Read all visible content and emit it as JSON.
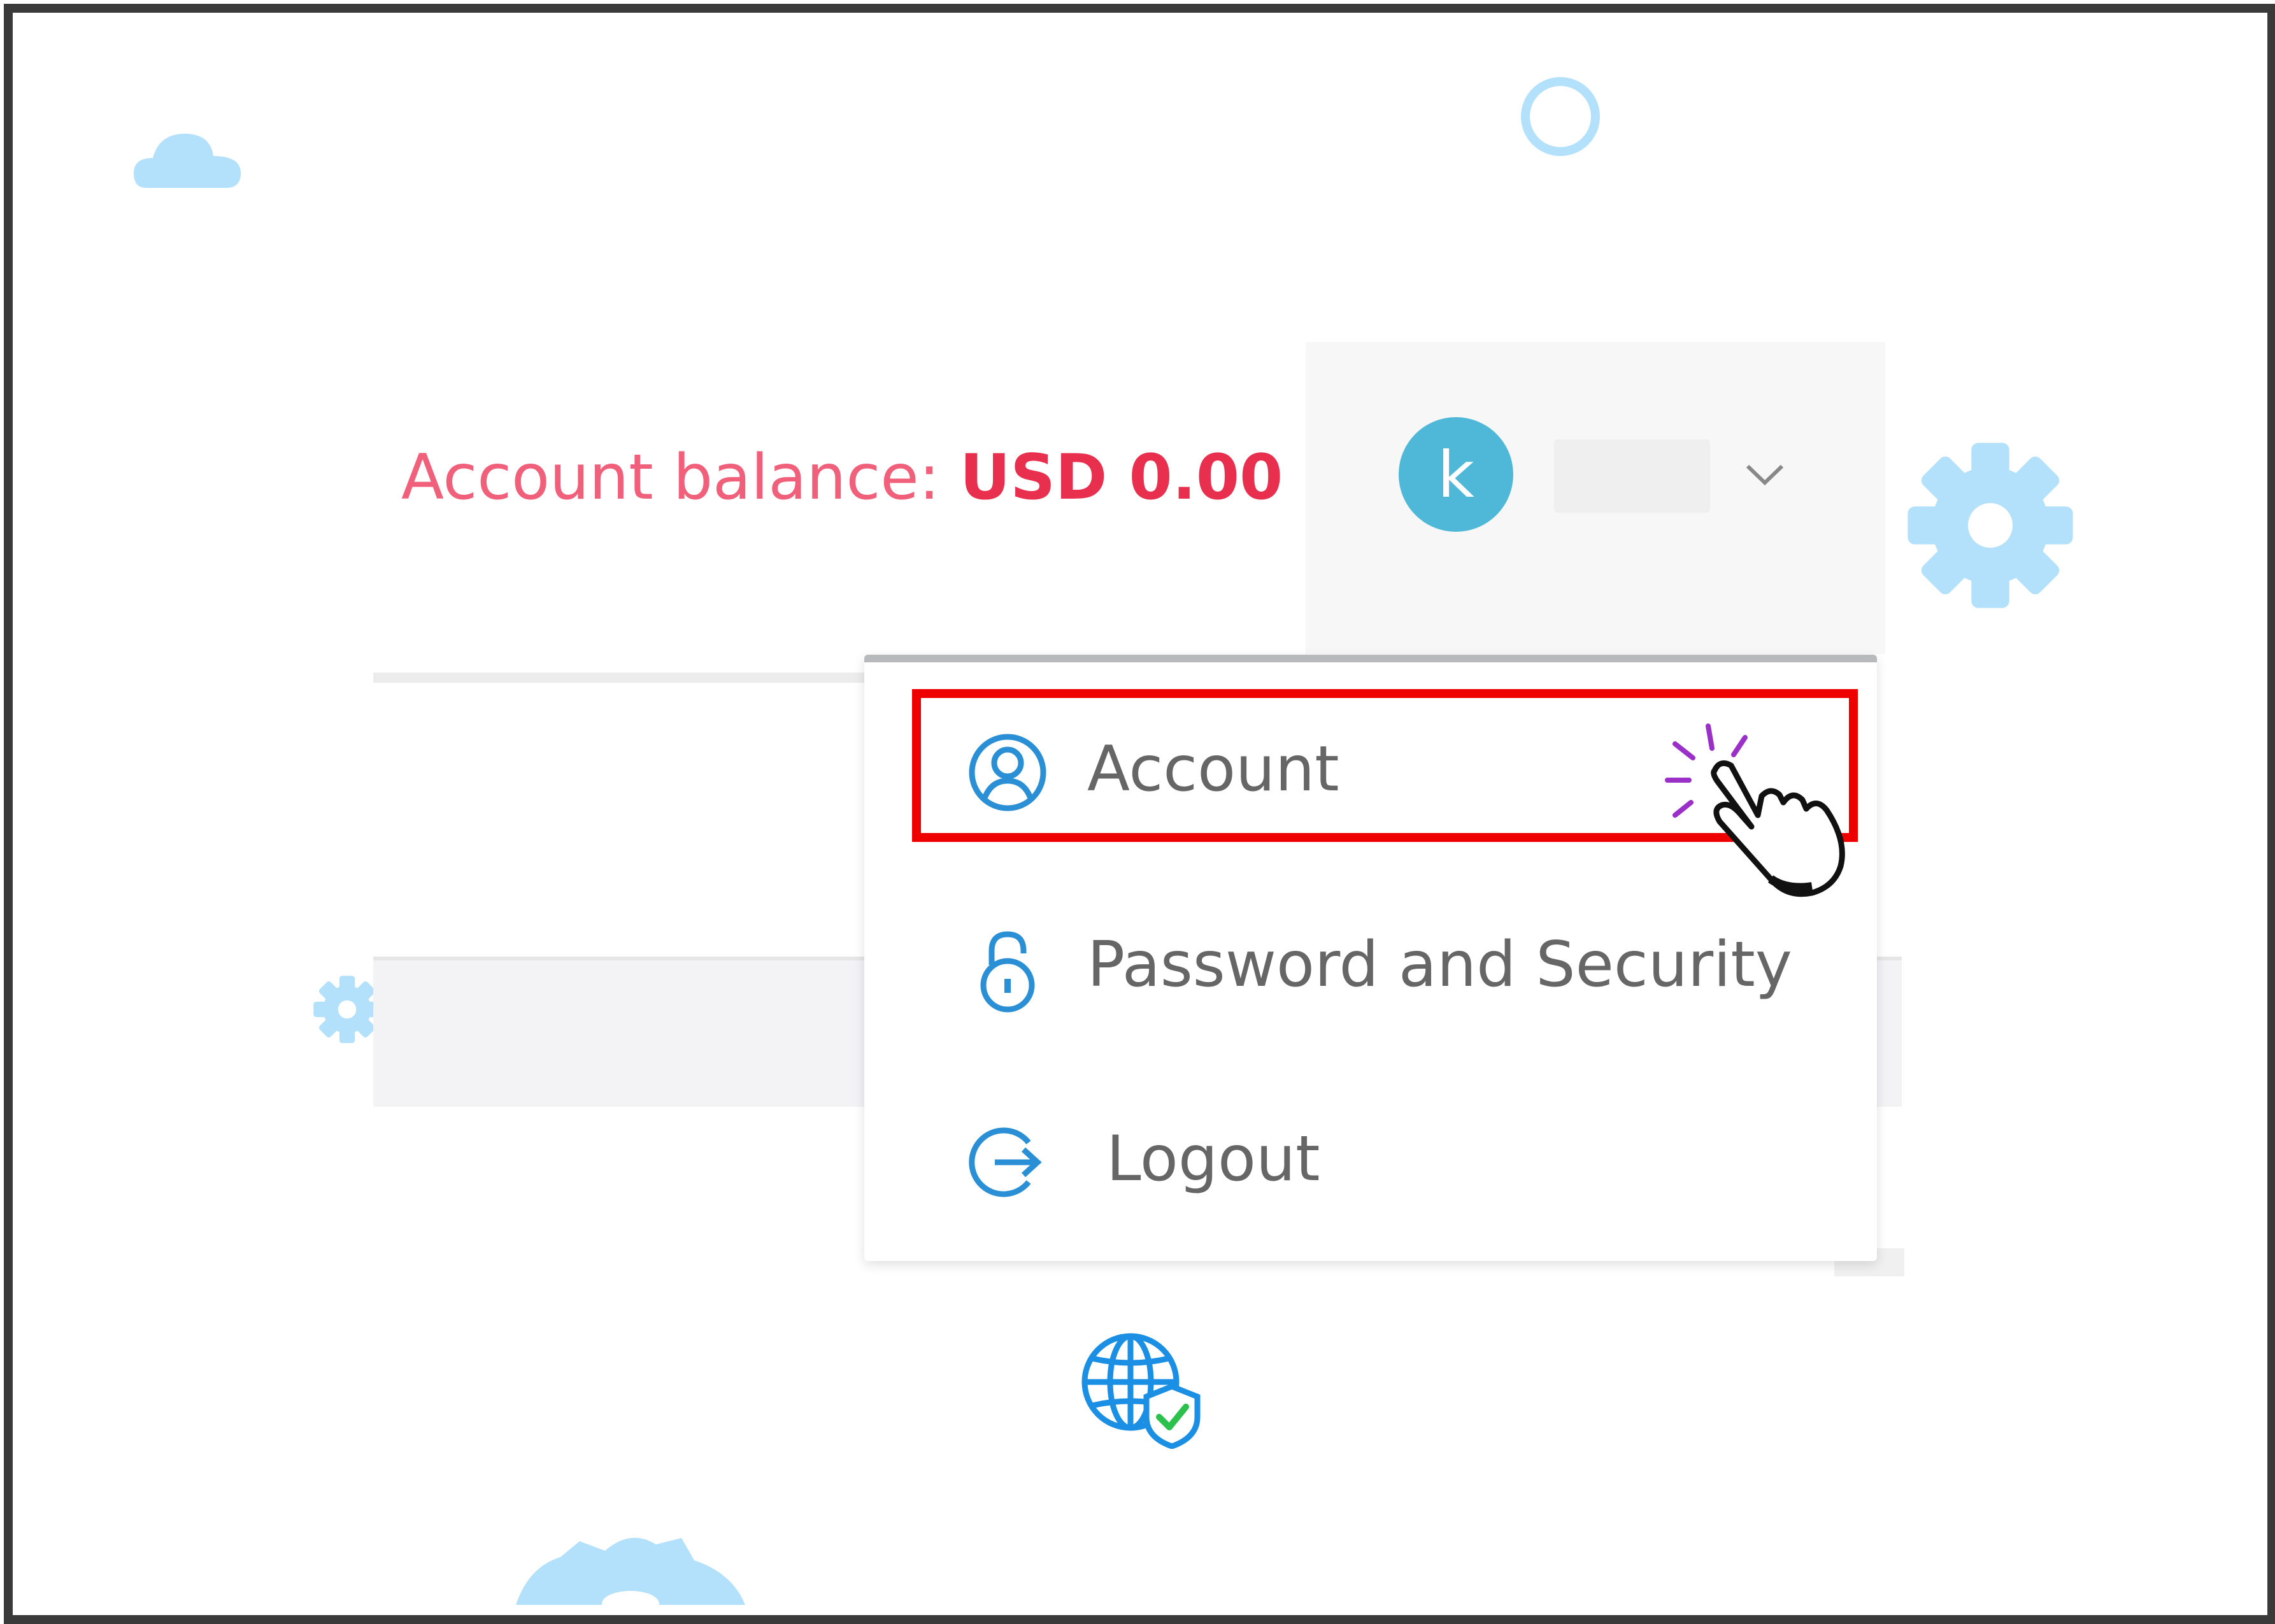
{
  "header": {
    "balance_label": "Account balance:",
    "balance_amount": "USD 0.00"
  },
  "user": {
    "avatar_initial": "k",
    "dropdown_icon": "chevron-down-icon"
  },
  "menu": {
    "items": [
      {
        "label": "Account",
        "icon": "user-circle-icon",
        "highlighted": true
      },
      {
        "label": "Password and Security",
        "icon": "lock-icon"
      },
      {
        "label": "Logout",
        "icon": "logout-icon"
      }
    ]
  },
  "colors": {
    "balance_label": "#f0607a",
    "balance_amount": "#e8304e",
    "avatar": "#4fb8d8",
    "menu_icon": "#2a8fd4",
    "highlight": "#ee0000",
    "deco": "#b3e0fb",
    "click_sparkle": "#9b30c8"
  }
}
